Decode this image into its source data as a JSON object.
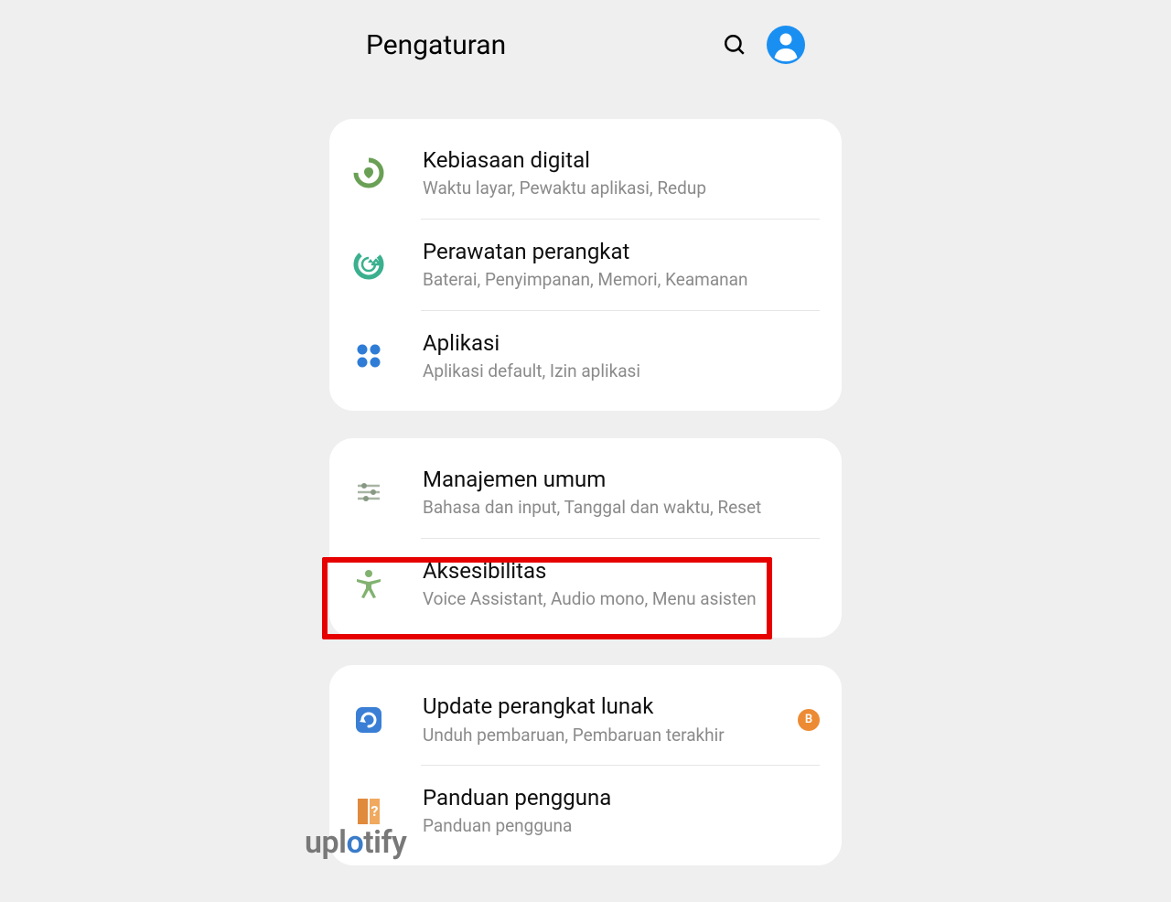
{
  "header": {
    "title": "Pengaturan"
  },
  "groups": [
    {
      "items": [
        {
          "title": "Kebiasaan digital",
          "subtitle": "Waktu layar, Pewaktu aplikasi, Redup",
          "icon": "digital-wellbeing"
        },
        {
          "title": "Perawatan perangkat",
          "subtitle": "Baterai, Penyimpanan, Memori, Keamanan",
          "icon": "device-care"
        },
        {
          "title": "Aplikasi",
          "subtitle": "Aplikasi default, Izin aplikasi",
          "icon": "apps"
        }
      ]
    },
    {
      "items": [
        {
          "title": "Manajemen umum",
          "subtitle": "Bahasa dan input, Tanggal dan waktu, Reset",
          "icon": "general"
        },
        {
          "title": "Aksesibilitas",
          "subtitle": "Voice Assistant, Audio mono, Menu asisten",
          "icon": "accessibility",
          "highlighted": true
        }
      ]
    },
    {
      "items": [
        {
          "title": "Update perangkat lunak",
          "subtitle": "Unduh pembaruan, Pembaruan terakhir",
          "icon": "update",
          "badge": "B"
        },
        {
          "title": "Panduan pengguna",
          "subtitle": "Panduan pengguna",
          "icon": "guide"
        }
      ]
    }
  ],
  "watermark": {
    "pre": "upl",
    "accent": "o",
    "post": "tify"
  }
}
